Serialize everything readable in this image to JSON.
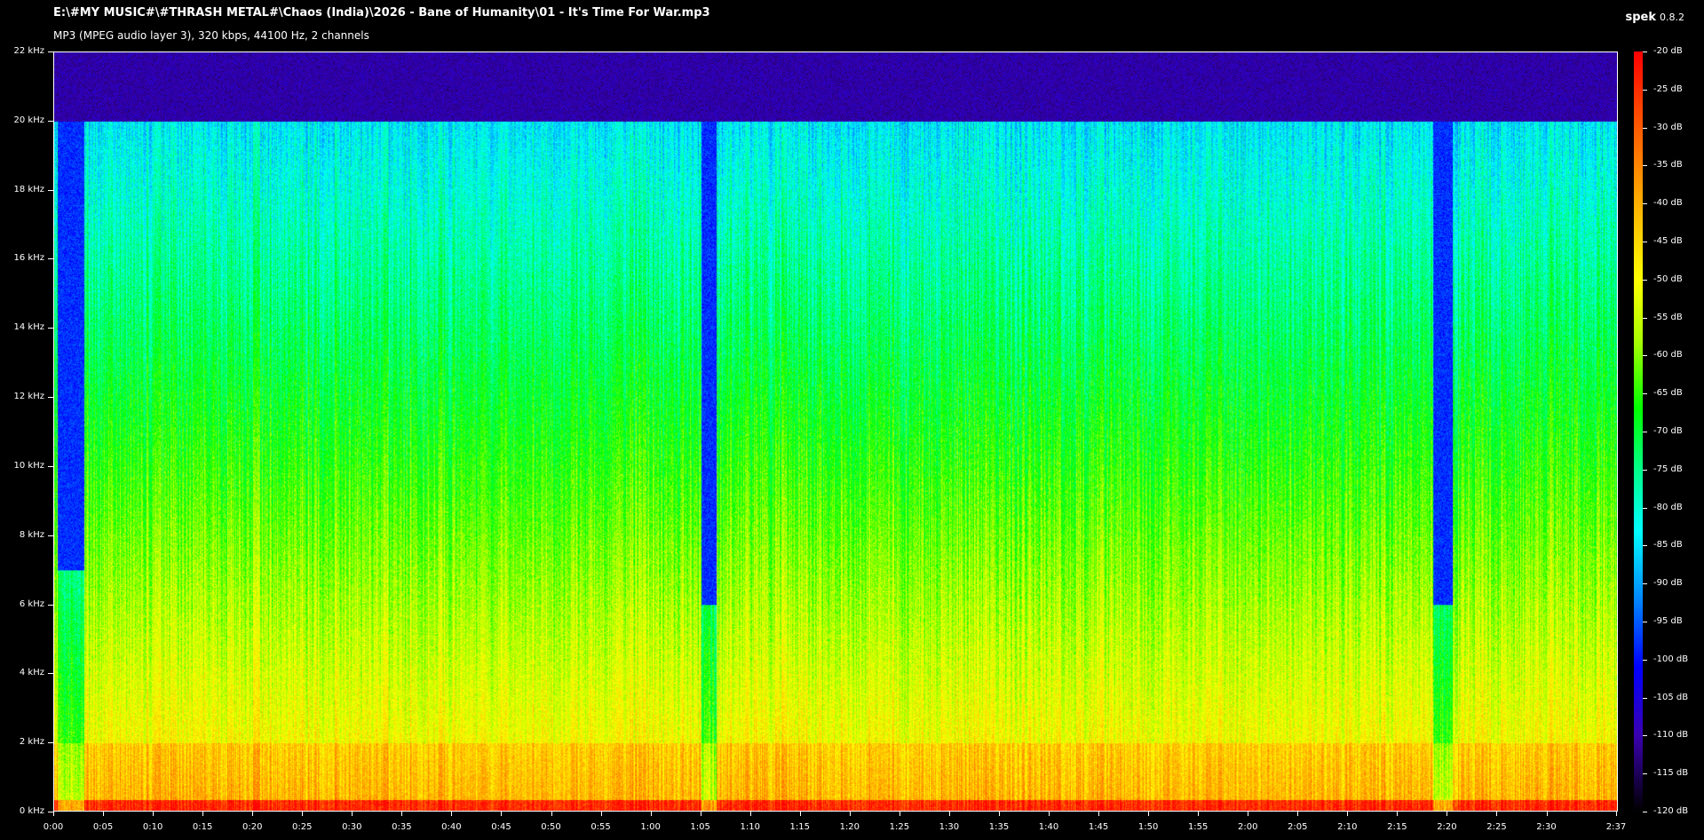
{
  "header": {
    "file_path": "E:\\#MY MUSIC#\\#THRASH METAL#\\Chaos (India)\\2026 - Bane of Humanity\\01 - It's Time For War.mp3",
    "file_info": "MP3 (MPEG audio layer 3), 320 kbps, 44100 Hz, 2 channels",
    "app_name": "spek",
    "app_version": "0.8.2"
  },
  "chart_data": {
    "type": "heatmap",
    "title": "",
    "xlabel": "",
    "ylabel": "",
    "xlim": [
      "0:00",
      "2:37"
    ],
    "ylim": [
      0,
      22
    ],
    "y_unit": "kHz",
    "duration_seconds": 157,
    "frequency_axis": {
      "ticks": [
        0,
        2,
        4,
        6,
        8,
        10,
        12,
        14,
        16,
        18,
        20,
        22
      ],
      "tick_labels": [
        "0 kHz",
        "2 kHz",
        "4 kHz",
        "6 kHz",
        "8 kHz",
        "10 kHz",
        "12 kHz",
        "14 kHz",
        "16 kHz",
        "18 kHz",
        "20 kHz",
        "22 kHz"
      ]
    },
    "time_axis": {
      "ticks_seconds": [
        0,
        5,
        10,
        15,
        20,
        25,
        30,
        35,
        40,
        45,
        50,
        55,
        60,
        65,
        70,
        75,
        80,
        85,
        90,
        95,
        100,
        105,
        110,
        115,
        120,
        125,
        130,
        135,
        140,
        145,
        150,
        157
      ],
      "tick_labels": [
        "0:00",
        "0:05",
        "0:10",
        "0:15",
        "0:20",
        "0:25",
        "0:30",
        "0:35",
        "0:40",
        "0:45",
        "0:50",
        "0:55",
        "1:00",
        "1:05",
        "1:10",
        "1:15",
        "1:20",
        "1:25",
        "1:30",
        "1:35",
        "1:40",
        "1:45",
        "1:50",
        "1:55",
        "2:00",
        "2:05",
        "2:10",
        "2:15",
        "2:20",
        "2:25",
        "2:30",
        "2:37"
      ]
    },
    "color_scale": {
      "ticks_db": [
        -20,
        -25,
        -30,
        -35,
        -40,
        -45,
        -50,
        -55,
        -60,
        -65,
        -70,
        -75,
        -80,
        -85,
        -90,
        -95,
        -100,
        -105,
        -110,
        -115,
        -120
      ],
      "tick_labels": [
        "-20 dB",
        "-25 dB",
        "-30 dB",
        "-35 dB",
        "-40 dB",
        "-45 dB",
        "-50 dB",
        "-55 dB",
        "-60 dB",
        "-65 dB",
        "-70 dB",
        "-75 dB",
        "-80 dB",
        "-85 dB",
        "-90 dB",
        "-95 dB",
        "-100 dB",
        "-105 dB",
        "-110 dB",
        "-115 dB",
        "-120 dB"
      ],
      "colors": [
        "#ff0000",
        "#ff5a00",
        "#ffb000",
        "#ffff00",
        "#aaff00",
        "#00ff00",
        "#00ff88",
        "#00ffff",
        "#0088ff",
        "#0000ff",
        "#3a00b0",
        "#000000"
      ]
    },
    "lowpass_cutoff_khz": 20,
    "spectral_events": [
      {
        "start_s": 0.3,
        "end_s": 3.0,
        "top_khz": 7
      },
      {
        "start_s": 65.0,
        "end_s": 66.5,
        "top_khz": 6
      },
      {
        "start_s": 138.5,
        "end_s": 140.5,
        "top_khz": 6
      }
    ]
  }
}
